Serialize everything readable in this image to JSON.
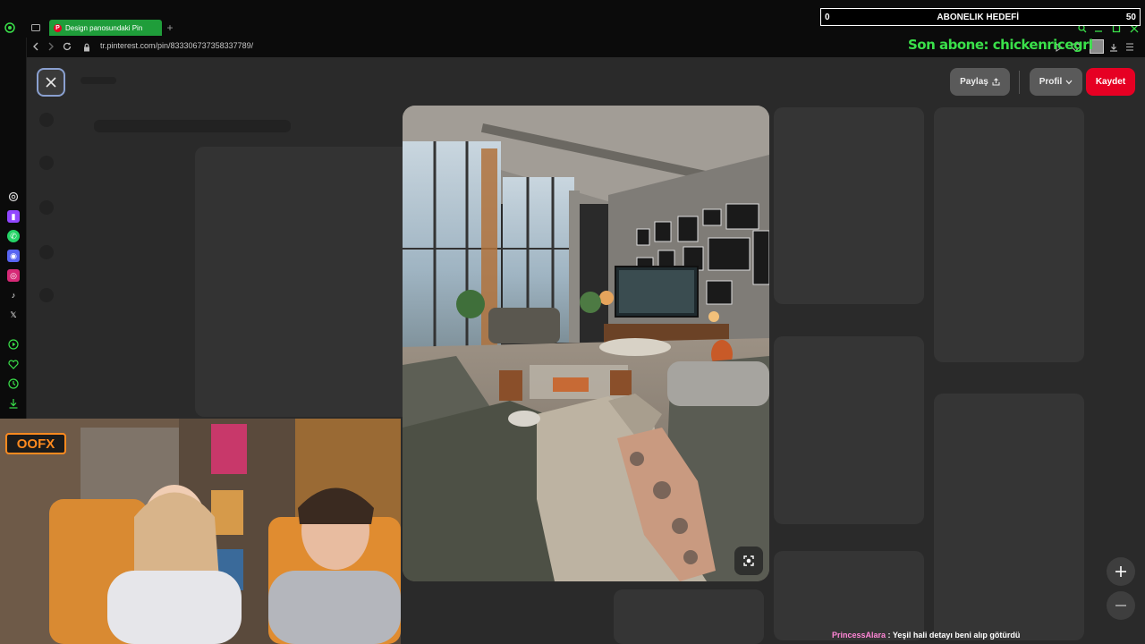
{
  "browser": {
    "tab_title": "Design panosundaki Pin",
    "url": "tr.pinterest.com/pin/833306737358337789/",
    "new_tab_symbol": "+"
  },
  "pinterest": {
    "share_label": "Paylaş",
    "profile_label": "Profil",
    "save_label": "Kaydet"
  },
  "stream_overlay": {
    "sub_goal_current": "0",
    "sub_goal_title": "ABONELIK HEDEFİ",
    "sub_goal_target": "50",
    "last_subscriber": "Son abone: chickenricegrl",
    "webcam_logo": "OOFX",
    "chat_user": "PrincessAlara",
    "chat_message": " : Yeşil hali detayı beni alıp götürdü"
  },
  "colors": {
    "save_red": "#e60023",
    "tab_green": "#1f9d3a",
    "overlay_green": "#3ae04a"
  }
}
